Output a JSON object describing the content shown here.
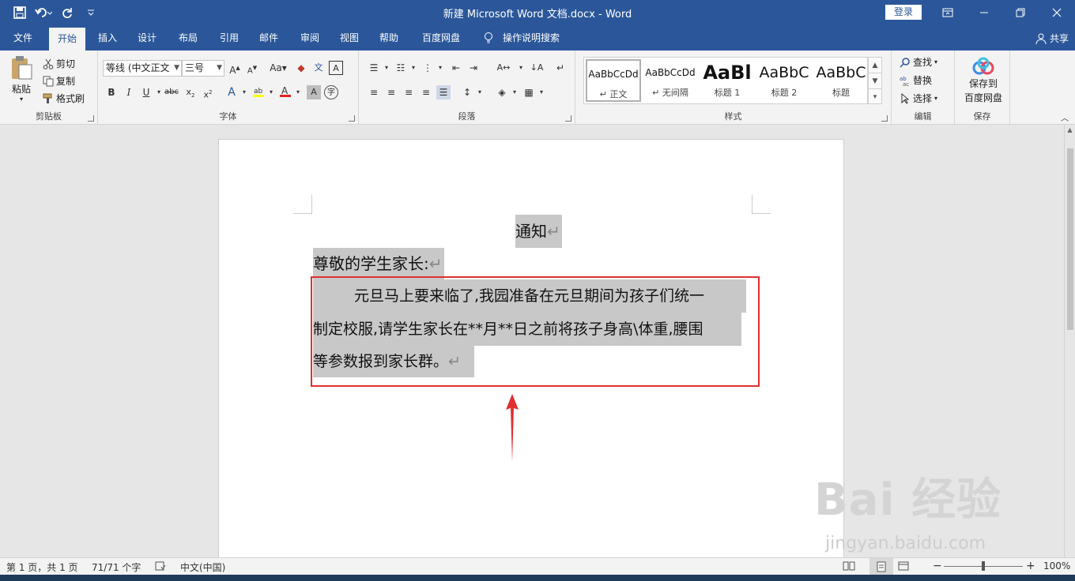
{
  "window": {
    "title": "新建 Microsoft Word 文档.docx - Word",
    "login_label": "登录"
  },
  "tabs": [
    {
      "label": "文件"
    },
    {
      "label": "开始"
    },
    {
      "label": "插入"
    },
    {
      "label": "设计"
    },
    {
      "label": "布局"
    },
    {
      "label": "引用"
    },
    {
      "label": "邮件"
    },
    {
      "label": "审阅"
    },
    {
      "label": "视图"
    },
    {
      "label": "帮助"
    },
    {
      "label": "百度网盘"
    },
    {
      "label": "操作说明搜索"
    }
  ],
  "share_label": "共享",
  "clipboard": {
    "paste": "粘贴",
    "cut": "剪切",
    "copy": "复制",
    "format_painter": "格式刷",
    "group": "剪贴板"
  },
  "font": {
    "family": "等线 (中文正文",
    "size": "三号",
    "group": "字体"
  },
  "paragraph": {
    "group": "段落"
  },
  "styles": {
    "items": [
      {
        "sample": "AaBbCcDd",
        "name": "正文"
      },
      {
        "sample": "AaBbCcDd",
        "name": "无间隔"
      },
      {
        "sample": "AaBl",
        "name": "标题 1"
      },
      {
        "sample": "AaBbC",
        "name": "标题 2"
      },
      {
        "sample": "AaBbC",
        "name": "标题"
      }
    ],
    "group": "样式"
  },
  "editing": {
    "find": "查找",
    "replace": "替换",
    "select": "选择",
    "group": "编辑"
  },
  "save": {
    "line1": "保存到",
    "line2": "百度网盘",
    "group": "保存"
  },
  "document": {
    "title": "通知",
    "greeting": "尊敬的学生家长:",
    "body_line1": "元旦马上要来临了,我园准备在元旦期间为孩子们统一",
    "body_line2": "制定校服,请学生家长在**月**日之前将孩子身高\\体重,腰围",
    "body_line3": "等参数报到家长群。",
    "para_mark": "↵"
  },
  "status": {
    "page": "第 1 页，共 1 页",
    "words": "71/71 个字",
    "language": "中文(中国)",
    "zoom": "100%"
  },
  "watermark": {
    "main": "Bai 经验",
    "url": "jingyan.baidu.com"
  },
  "colors": {
    "accent": "#2b579a",
    "highlight": "#c8c8c8",
    "annotation": "#e03030"
  }
}
